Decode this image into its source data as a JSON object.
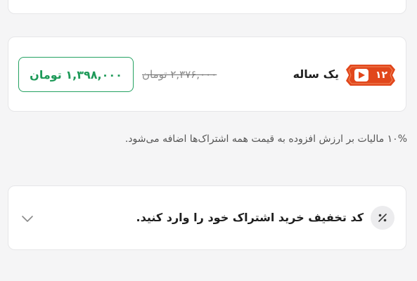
{
  "plan": {
    "badge_number": "۱۲",
    "title": "یک ساله",
    "old_price": "۲,۳۷۶,۰۰۰ تومان",
    "price": "۱,۳۹۸,۰۰۰ تومان"
  },
  "vat_note": "۱۰% مالیات بر ارزش افزوده به قیمت همه اشتراک‌ها اضافه می‌شود.",
  "promo": {
    "icon": "percent-icon",
    "label": "کد تخفیف خرید اشتراک خود را وارد کنید."
  },
  "colors": {
    "badge": "#e1471c",
    "price_green": "#1e9a59",
    "background": "#f5f5f6"
  }
}
